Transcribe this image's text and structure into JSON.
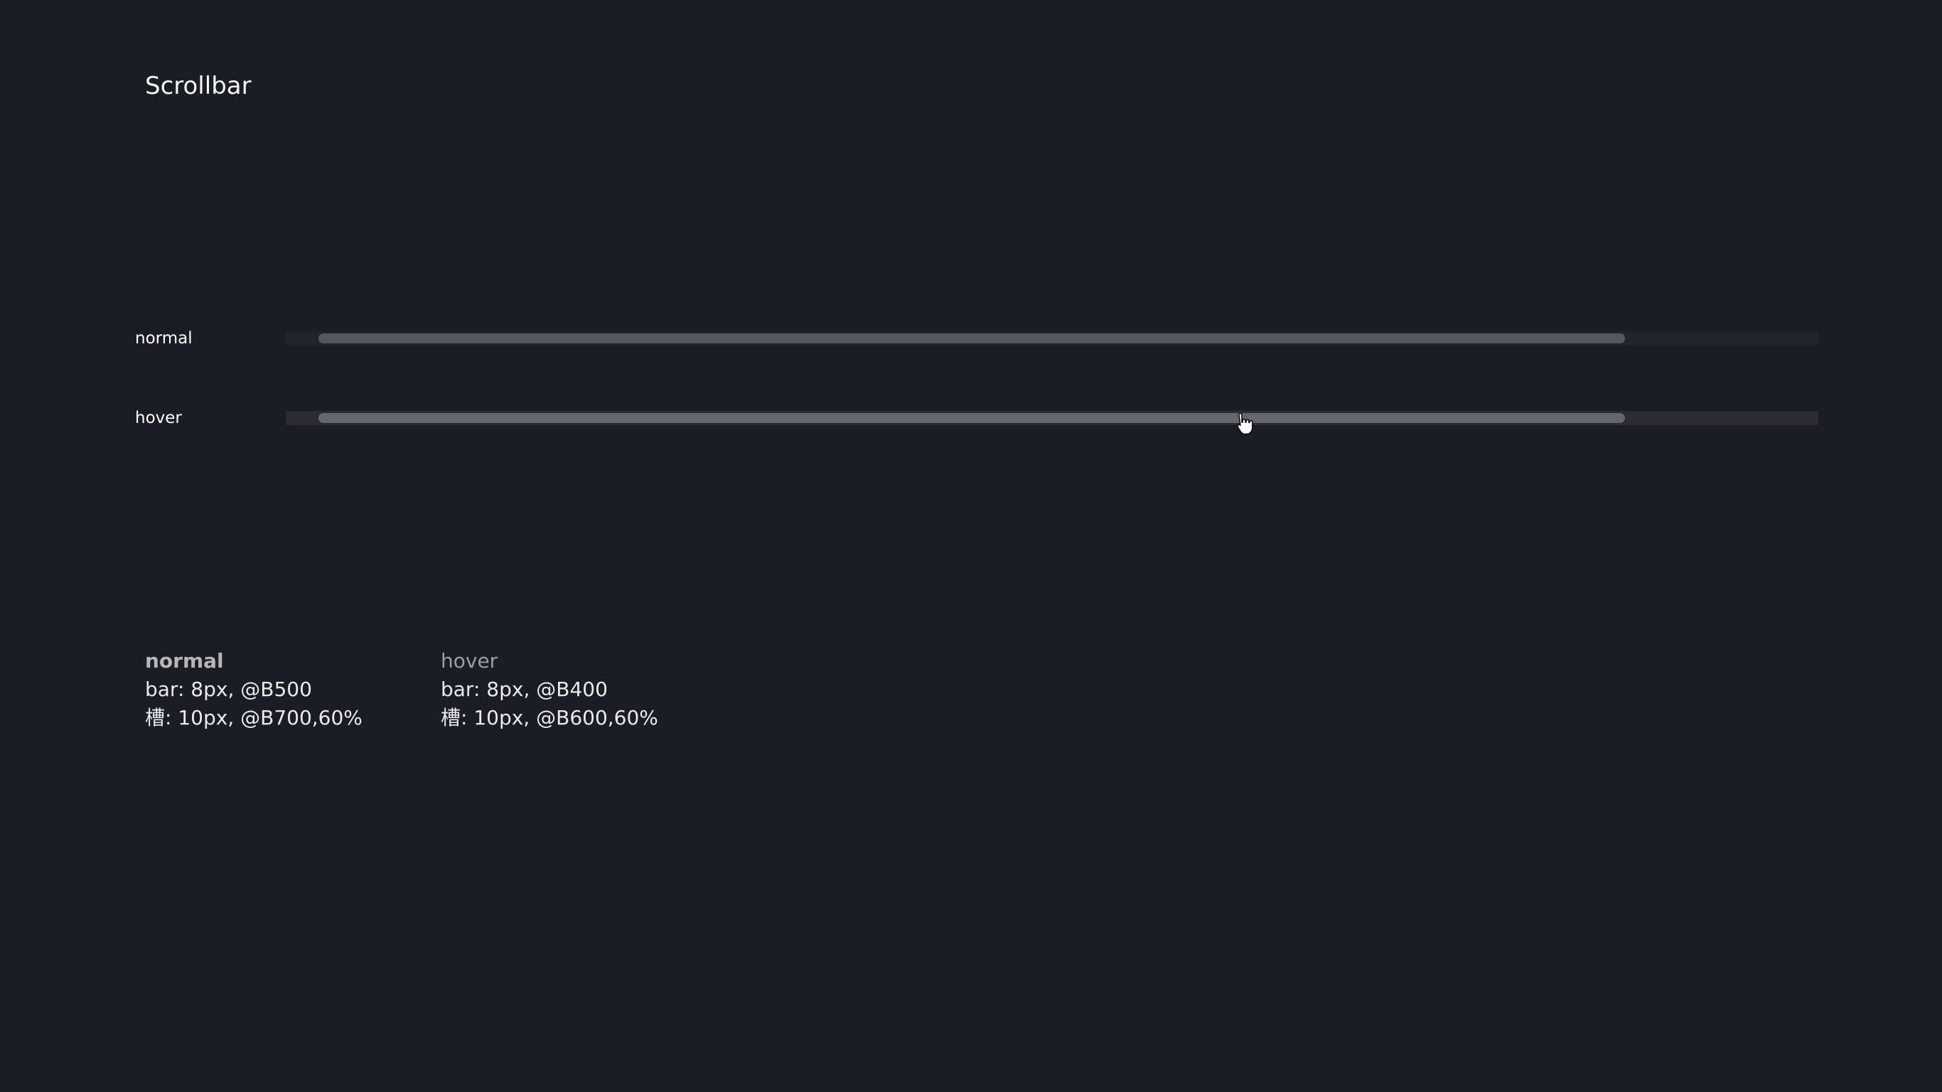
{
  "page": {
    "title": "Scrollbar",
    "background": "#1b1d24"
  },
  "demo": {
    "rows": [
      {
        "label": "normal",
        "bar_color": "#55575f",
        "track_color": "#24262d"
      },
      {
        "label": "hover",
        "bar_color": "#65676e",
        "track_color": "#2a2c32",
        "cursor_icon": "hand-pointer-icon"
      }
    ]
  },
  "specs": [
    {
      "heading": "normal",
      "lines": [
        "bar: 8px, @B500",
        "槽: 10px, @B700,60%"
      ]
    },
    {
      "heading": "hover",
      "lines": [
        "bar: 8px, @B400",
        "槽: 10px, @B600,60%"
      ]
    }
  ]
}
